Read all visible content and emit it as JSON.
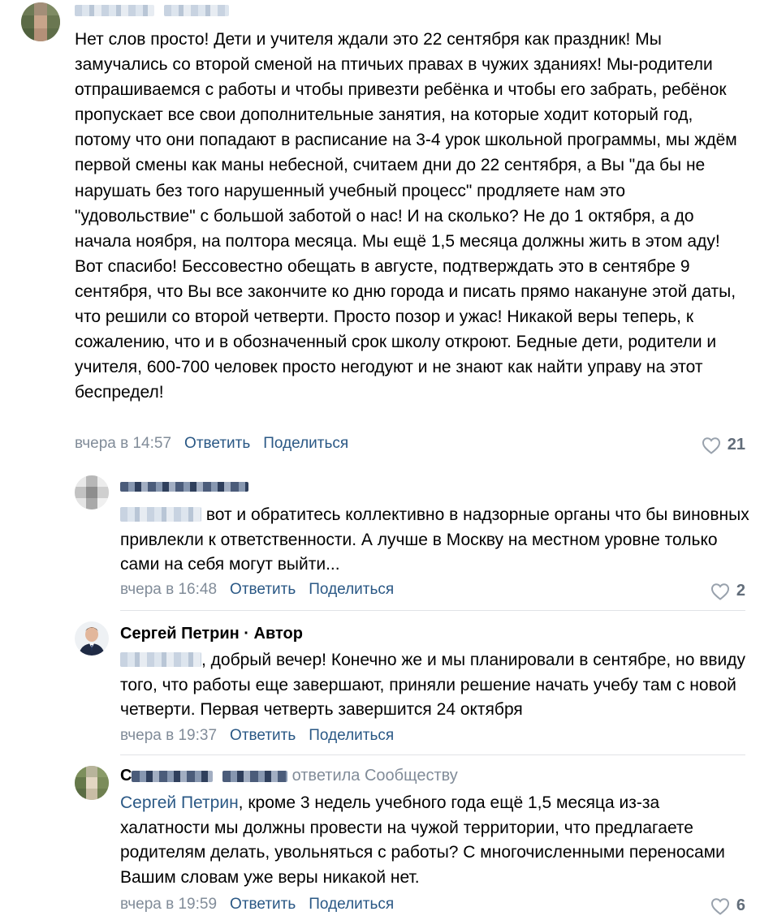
{
  "colors": {
    "link": "#2a5885",
    "meta": "#818c99",
    "likes": "#626d7a",
    "divider": "#e1e3e6",
    "text": "#000000"
  },
  "icons": {
    "like": "heart-outline-icon"
  },
  "comment": {
    "text": "Нет слов просто! Дети и учителя ждали это 22 сентября как праздник! Мы замучались со второй сменой на птичьих правах в чужих зданиях! Мы-родители отпрашиваемся с работы и чтобы привезти ребёнка и чтобы его забрать, ребёнок пропускает все свои дополнительные занятия, на которые ходит который год, потому что они попадают в расписание на 3-4 урок школьной программы, мы ждём первой смены как маны небесной, считаем дни до 22 сентября, а Вы \"да бы не нарушать без того нарушенный учебный процесс\" продляете нам это \"удовольствие\" с большой заботой о нас! И на сколько? Не до 1 октября, а до начала ноября, на полтора месяца. Мы ещё 1,5 месяца должны жить в этом аду! Вот спасибо! Бессовестно обещать в августе, подтверждать это в сентябре 9 сентября, что Вы все закончите ко дню города и писать прямо накануне этой даты, что решили со второй четверти. Просто позор и ужас! Никакой веры теперь, к сожалению, что и в обозначенный срок школу откроют. Бедные дети, родители и учителя, 600-700 человек просто негодуют и не знают как найти управу на этот беспредел!",
    "time": "вчера в 14:57",
    "reply_label": "Ответить",
    "share_label": "Поделиться",
    "likes": "21"
  },
  "replies": [
    {
      "text": "вот и обратитесь коллективно в надзорные органы что бы виновных привлекли к ответственности. А лучше в Москву на местном уровне только сами на себя могут выйти...",
      "time": "вчера в 16:48",
      "reply_label": "Ответить",
      "share_label": "Поделиться",
      "likes": "2"
    },
    {
      "author": "Сергей Петрин",
      "badge": "· Автор",
      "text": ", добрый вечер! Конечно же и мы планировали в сентябре, но ввиду того, что работы еще завершают, приняли решение начать учебу там с новой четверти. Первая четверть завершится 24 октября",
      "time": "вчера в 19:37",
      "reply_label": "Ответить",
      "share_label": "Поделиться"
    },
    {
      "author_initial": "С",
      "reply_to": "ответила Сообществу",
      "mention": "Сергей Петрин",
      "text": ", кроме 3 недель учебного года ещё 1,5 месяца из-за халатности мы должны провести на чужой территории, что предлагаете родителям делать, увольняться с работы? С многочисленными переносами Вашим словам уже веры никакой нет.",
      "time": "вчера в 19:59",
      "reply_label": "Ответить",
      "share_label": "Поделиться",
      "likes": "6"
    }
  ]
}
